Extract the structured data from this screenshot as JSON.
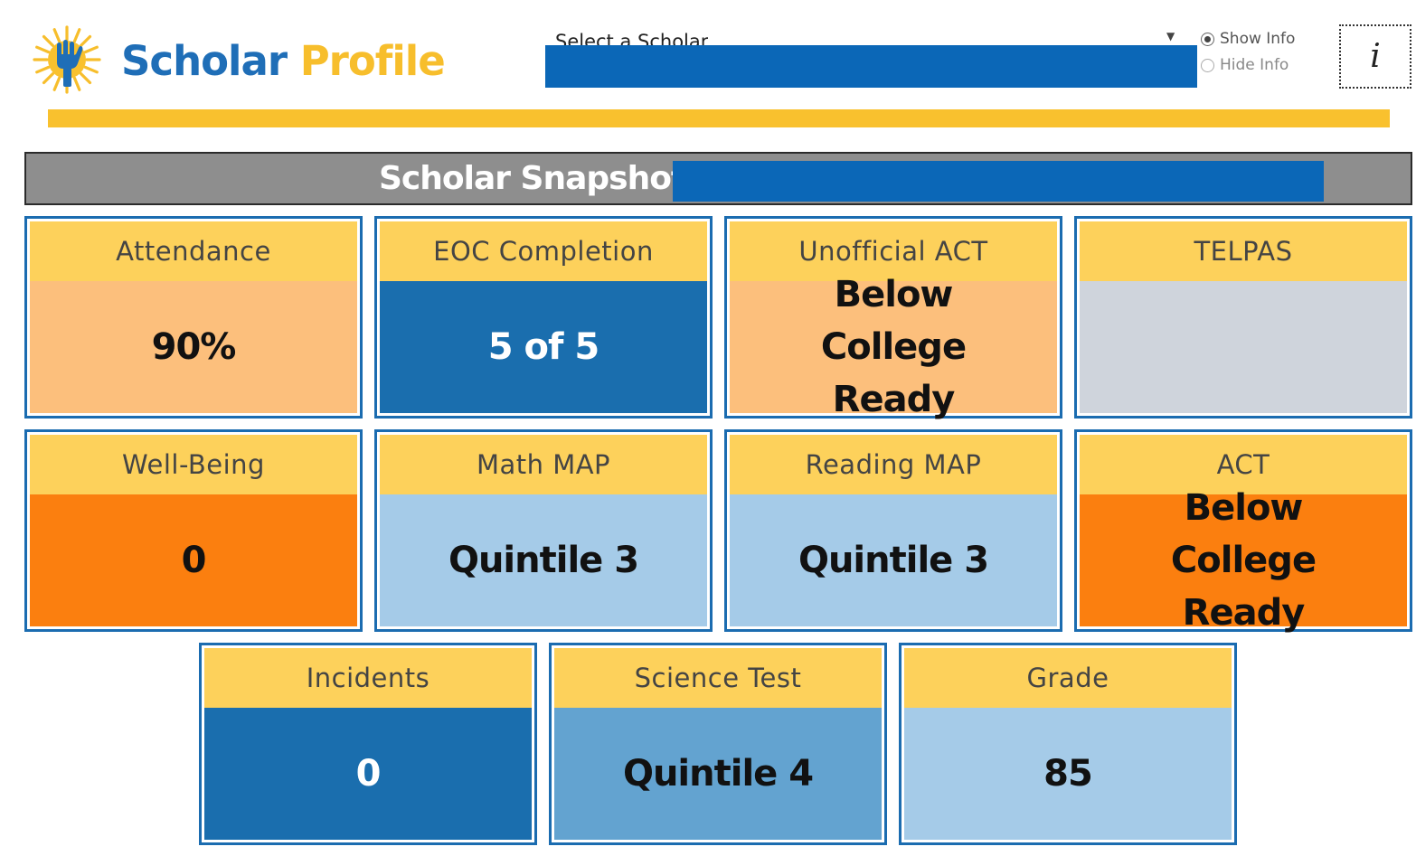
{
  "header": {
    "title_part1": "Scholar",
    "title_part2": "Profile",
    "logo_icon": "hand-sun-logo-icon",
    "select_label": "Select a Scholar",
    "select_value": "",
    "radio_show": "Show Info",
    "radio_hide": "Hide Info",
    "radio_selected": "Show Info",
    "info_glyph": "i"
  },
  "snapshot": {
    "label": "Scholar Snapshot:",
    "value": ""
  },
  "tiles": [
    {
      "label": "Attendance",
      "value": "90%",
      "bg": "#fcbf7c"
    },
    {
      "label": "EOC Completion",
      "value": "5 of 5",
      "bg": "#1a6eae"
    },
    {
      "label": "Unofficial ACT",
      "value": "Below College Ready",
      "bg": "#fcbf7c"
    },
    {
      "label": "TELPAS",
      "value": "",
      "bg": "#cfd4dc"
    },
    {
      "label": "Well-Being",
      "value": "0",
      "bg": "#fb7f0f"
    },
    {
      "label": "Math MAP",
      "value": "Quintile 3",
      "bg": "#a5cbe8"
    },
    {
      "label": "Reading MAP",
      "value": "Quintile 3",
      "bg": "#a5cbe8"
    },
    {
      "label": "ACT",
      "value": "Below College Ready",
      "bg": "#fb7f0f"
    },
    {
      "label": "Incidents",
      "value": "0",
      "bg": "#1a6eae"
    },
    {
      "label": "Science Test",
      "value": "Quintile 4",
      "bg": "#63a3d0"
    },
    {
      "label": "Grade",
      "value": "85",
      "bg": "#a5cbe8"
    }
  ],
  "colors": {
    "brand_blue": "#1f6eb7",
    "brand_gold": "#f7be2c",
    "tile_header": "#fdd15b",
    "tile_border": "#1b6cb0",
    "redaction": "#0b67b7"
  }
}
